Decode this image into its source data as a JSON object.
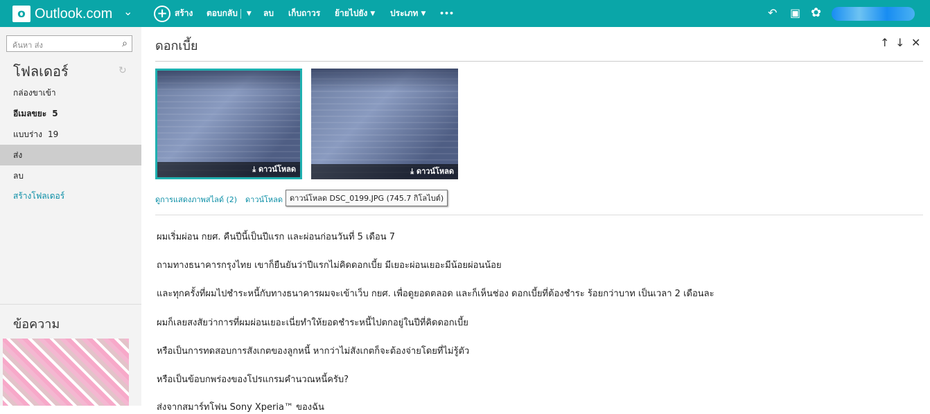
{
  "topbar": {
    "logo_glyph": "o",
    "brand": "Outlook.com",
    "chev": "⌄",
    "new_label": "สร้าง",
    "reply_label": "ตอบกลับ",
    "delete_label": "ลบ",
    "archive_label": "เก็บถาวร",
    "move_label": "ย้ายไปยัง",
    "category_label": "ประเภท",
    "more_label": "•••",
    "undo_icon": "↶",
    "chat_icon": "▣",
    "gear_icon": "✿"
  },
  "sidebar": {
    "search_placeholder": "ค้นหา ส่ง",
    "search_icon": "⌕",
    "folders_title": "โฟลเดอร์",
    "refresh_icon": "↻",
    "items": [
      {
        "label": "กล่องขาเข้า",
        "count": ""
      },
      {
        "label": "อีเมลขยะ",
        "count": "5"
      },
      {
        "label": "แบบร่าง",
        "count": "19"
      },
      {
        "label": "ส่ง",
        "count": ""
      },
      {
        "label": "ลบ",
        "count": ""
      }
    ],
    "create_folder": "สร้างโฟลเดอร์",
    "messages_title": "ข้อความ"
  },
  "message": {
    "subject": "ดอกเบี้ย",
    "up_icon": "↑",
    "down_icon": "↓",
    "close_icon": "✕",
    "download_label": "ดาวน์โหลด",
    "download_icon": "⤓",
    "slideshow_link": "ดูการแสดงภาพสไลด์ (2)",
    "download_all_link": "ดาวน์โหลด",
    "tooltip": "ดาวน์โหลด DSC_0199.JPG (745.7 กิโลไบต์)",
    "body": [
      "ผมเริ่มผ่อน กยศ. คืนปีนี้เป็นปีแรก และผ่อนก่อนวันที่ 5 เดือน 7",
      "ถามทางธนาคารกรุงไทย เขาก็ยืนยันว่าปีแรกไม่คิดดอกเบี้ย มีเยอะผ่อนเยอะมีน้อยผ่อนน้อย",
      "และทุกครั้งที่ผมไปชำระหนี้กับทางธนาคารผมจะเข้าเว็บ กยศ. เพื่อดูยอดตลอด และก็เห็นช่อง ดอกเบี้ยที่ต้องชำระ ร้อยกว่าบาท เป็นเวลา 2 เดือนละ",
      "ผมก็เลยสงสัยว่าการที่ผมผ่อนเยอะเนี่ยทำให้ยอดชำระหนี้ไปตกอยู่ในปีที่คิดดอกเบี้ย",
      "หรือเป็นการทดสอบการสังเกตของลูกหนี้ หากว่าไม่สังเกตก็จะต้องจ่ายโดยที่ไม่รู้ตัว",
      "หรือเป็นข้อบกพร่องของโปรแกรมคำนวณหนี้ครับ?",
      "ส่งจากสมาร์ทโฟน Sony Xperia™ ของฉัน"
    ]
  }
}
